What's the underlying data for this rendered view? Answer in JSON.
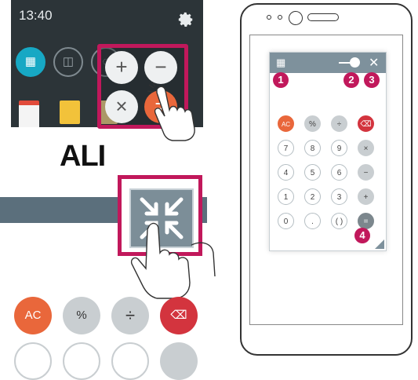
{
  "notification": {
    "time": "13:40"
  },
  "popup_buttons": [
    "+",
    "−",
    "×",
    "="
  ],
  "label": "ALI",
  "bottom_keys": [
    {
      "label": "AC",
      "style": "orange"
    },
    {
      "label": "%",
      "style": "gray"
    },
    {
      "label": "÷",
      "style": "gray"
    },
    {
      "label": "⌫",
      "style": "red"
    }
  ],
  "calculator": {
    "rows": [
      [
        {
          "label": "AC",
          "style": "o"
        },
        {
          "label": "%",
          "style": "g"
        },
        {
          "label": "÷",
          "style": "g"
        },
        {
          "label": "⌫",
          "style": "r"
        }
      ],
      [
        {
          "label": "7",
          "style": ""
        },
        {
          "label": "8",
          "style": ""
        },
        {
          "label": "9",
          "style": ""
        },
        {
          "label": "×",
          "style": "g"
        }
      ],
      [
        {
          "label": "4",
          "style": ""
        },
        {
          "label": "5",
          "style": ""
        },
        {
          "label": "6",
          "style": ""
        },
        {
          "label": "−",
          "style": "g"
        }
      ],
      [
        {
          "label": "1",
          "style": ""
        },
        {
          "label": "2",
          "style": ""
        },
        {
          "label": "3",
          "style": ""
        },
        {
          "label": "+",
          "style": "g"
        }
      ],
      [
        {
          "label": "0",
          "style": ""
        },
        {
          "label": ".",
          "style": ""
        },
        {
          "label": "( )",
          "style": ""
        },
        {
          "label": "=",
          "style": "dark"
        }
      ]
    ]
  },
  "callouts": [
    "1",
    "2",
    "3",
    "4"
  ],
  "colors": {
    "highlight": "#c1185b",
    "orange": "#e9673b",
    "red": "#d3343e",
    "titlebar": "#7e919c"
  }
}
